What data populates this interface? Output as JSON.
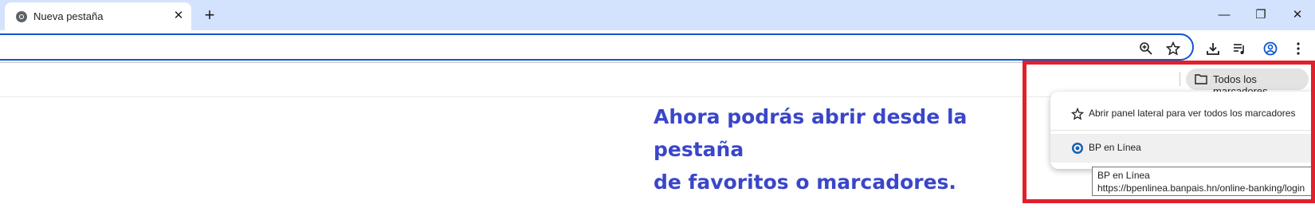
{
  "tab": {
    "title": "Nueva pestaña",
    "close_glyph": "✕",
    "favicon": "chrome-icon"
  },
  "tabstrip": {
    "new_tab_glyph": "+"
  },
  "window_controls": {
    "minimize": "—",
    "restore": "❐",
    "close": "✕"
  },
  "toolbar": {
    "icons": [
      "zoom-icon",
      "star-icon",
      "download-icon",
      "reading-list-icon",
      "profile-icon",
      "menu-icon"
    ]
  },
  "bookmarks_bar": {
    "all_bookmarks_label": "Todos los marcadores",
    "icon": "folder-icon"
  },
  "annotation": {
    "line1": "Ahora podrás abrir desde la pestaña",
    "line2": "de favoritos o marcadores."
  },
  "menu": {
    "items": [
      {
        "label": "Abrir panel lateral para ver todos los marcadores",
        "icon": "side-panel-star-icon"
      },
      {
        "label": "BP en Línea",
        "icon": "site-favicon-icon"
      }
    ]
  },
  "tooltip": {
    "title": "BP en Línea",
    "url": "https://bpenlinea.banpais.hn/online-banking/login"
  },
  "colors": {
    "accent": "#0b57d0",
    "annotation": "#3a46c9",
    "highlight": "#e0202a",
    "tabstrip": "#d3e3fd"
  }
}
